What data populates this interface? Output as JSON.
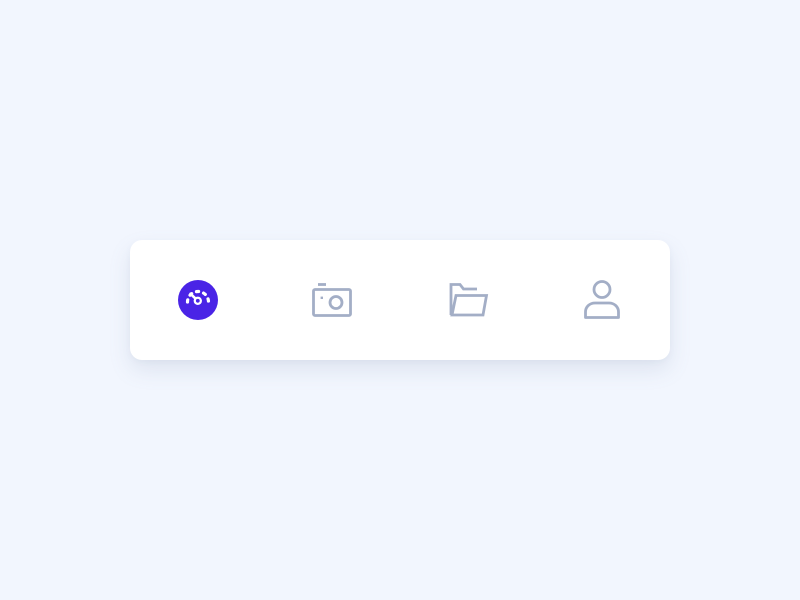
{
  "colors": {
    "page_background": "#f2f6fe",
    "bar_background": "#ffffff",
    "active": "#4a24e6",
    "inactive": "#a3aec6"
  },
  "tabbar": {
    "active_index": 0,
    "items": [
      {
        "icon": "speedometer-icon",
        "state": "active"
      },
      {
        "icon": "camera-icon",
        "state": "inactive"
      },
      {
        "icon": "folder-open-icon",
        "state": "inactive"
      },
      {
        "icon": "user-icon",
        "state": "inactive"
      }
    ]
  }
}
